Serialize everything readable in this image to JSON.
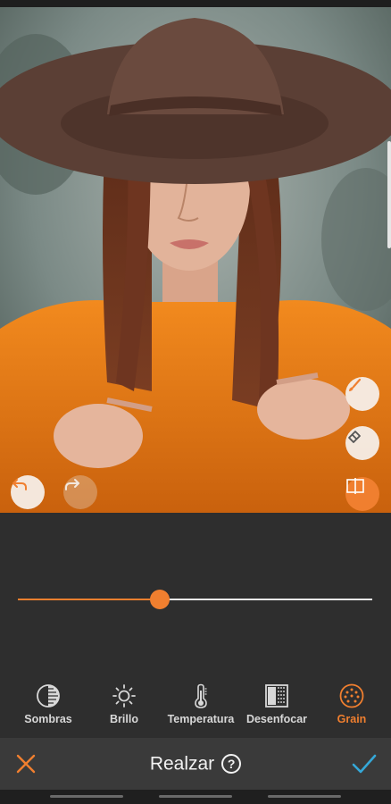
{
  "screen": {
    "title": "Realzar",
    "help_glyph": "?"
  },
  "photo": {
    "description_icon": "portrait-photo"
  },
  "floating_actions": {
    "undo": "undo-icon",
    "redo": "redo-icon",
    "brush": "brush-icon",
    "eraser": "eraser-icon",
    "compare": "compare-icon"
  },
  "slider": {
    "value": 0.4
  },
  "tools": [
    {
      "label": "Sombras",
      "icon": "shadows-icon"
    },
    {
      "label": "Brillo",
      "icon": "brightness-icon"
    },
    {
      "label": "Temperatura",
      "icon": "thermometer-icon"
    },
    {
      "label": "Desenfocar",
      "icon": "blur-icon"
    },
    {
      "label": "Grain",
      "icon": "grain-icon",
      "active": true
    }
  ],
  "colors": {
    "accent": "#f07f2f",
    "confirm": "#35a8d8",
    "panel": "#2e2e2e"
  }
}
